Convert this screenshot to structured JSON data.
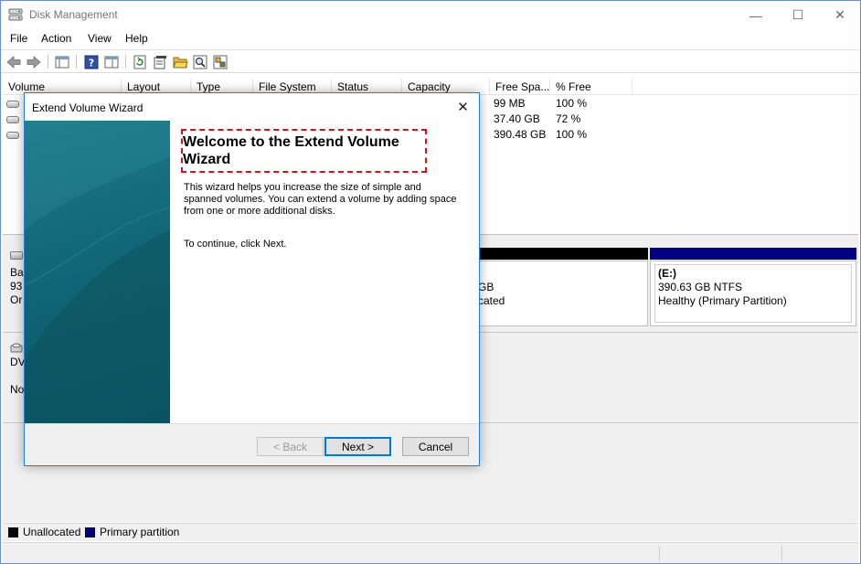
{
  "window": {
    "title": "Disk Management",
    "minimize_glyph": "—",
    "maximize_glyph": "☐",
    "close_glyph": "✕"
  },
  "menu": [
    "File",
    "Action",
    "View",
    "Help"
  ],
  "toolbar": {
    "icons": [
      "back-icon",
      "forward-icon",
      "console-tree-icon",
      "help-icon",
      "properties-pane-icon",
      "refresh-icon",
      "properties-icon",
      "open-icon",
      "search-icon",
      "settings-icon"
    ]
  },
  "volume_list": {
    "columns": [
      "Volume",
      "Layout",
      "Type",
      "File System",
      "Status",
      "Capacity",
      "Free Spa...",
      "% Free"
    ],
    "rows": [
      {
        "free_space": "99 MB",
        "pct_free": "100 %"
      },
      {
        "free_space": "37.40 GB",
        "pct_free": "72 %"
      },
      {
        "free_space": "390.48 GB",
        "pct_free": "100 %"
      }
    ]
  },
  "disk_pane": {
    "disk0": {
      "label_line1": "Ba",
      "label_line2": "93",
      "label_line3": "Or"
    },
    "partial_partition": {
      "size_fragment": "GB",
      "status_fragment": "cated"
    },
    "partition_e": {
      "name": "(E:)",
      "size_fs": "390.63 GB NTFS",
      "status": "Healthy (Primary Partition)"
    },
    "cdrom": {
      "label_line1": "DV",
      "label_line2": "No"
    }
  },
  "legend": [
    {
      "label": "Unallocated",
      "color": "#000000"
    },
    {
      "label": "Primary partition",
      "color": "#000080"
    }
  ],
  "wizard": {
    "title": "Extend Volume Wizard",
    "close_glyph": "✕",
    "heading": "Welcome to the Extend Volume Wizard",
    "description": "This wizard helps you increase the size of simple and spanned volumes. You can extend a volume  by adding space from one or more additional disks.",
    "continue_text": "To continue, click Next.",
    "back_label": "< Back",
    "next_label": "Next >",
    "cancel_label": "Cancel"
  },
  "colors": {
    "accent_border": "#1883d7",
    "highlight_dash": "#d9101c",
    "primary_partition": "#000080",
    "banner_teal": "#136879"
  }
}
